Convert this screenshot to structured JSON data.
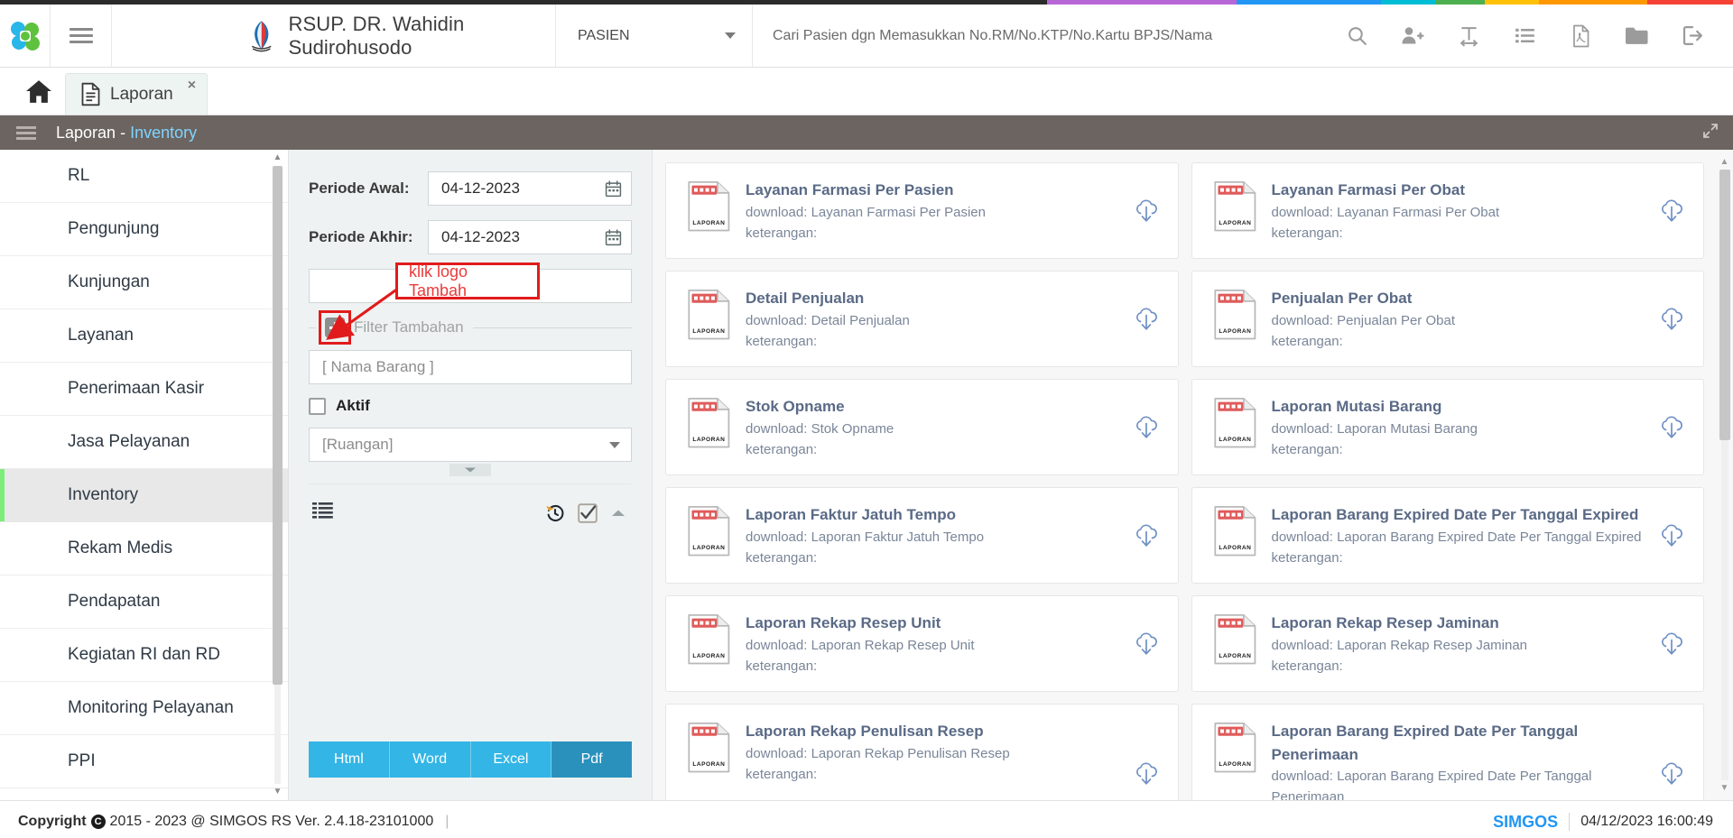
{
  "rainbow_colors": [
    "#2b2b2b",
    "#b766d6",
    "#2196f3",
    "#00bcd4",
    "#4caf50",
    "#ffc107",
    "#ff9800",
    "#f44336"
  ],
  "header": {
    "logo_icon": "simgos-logo-icon",
    "menu_icon": "hamburger-icon",
    "hospital_icon": "hospital-logo-icon",
    "hospital_name": "RSUP. DR. Wahidin Sudirohusodo",
    "select": {
      "value": "PASIEN",
      "caret_icon": "chevron-down-icon"
    },
    "search": {
      "value": "",
      "placeholder": "Cari Pasien dgn Memasukkan No.RM/No.KTP/No.Kartu BPJS/Nama"
    },
    "icons": [
      {
        "name": "search-icon",
        "title": "Cari"
      },
      {
        "name": "add-user-icon",
        "title": "Tambah Pasien"
      },
      {
        "name": "text-width-icon",
        "title": "Teks"
      },
      {
        "name": "list-icon",
        "title": "Daftar"
      },
      {
        "name": "pdf-file-icon",
        "title": "PDF"
      },
      {
        "name": "folder-icon",
        "title": "Folder"
      },
      {
        "name": "logout-icon",
        "title": "Keluar"
      }
    ]
  },
  "tabbar": {
    "home_icon": "home-icon",
    "tabs": [
      {
        "label": "Laporan",
        "icon": "document-icon",
        "close": "×",
        "active": true
      }
    ]
  },
  "titlebar": {
    "menu_icon": "hamburger-icon",
    "title_main": "Laporan",
    "title_sep": " - ",
    "title_accent": "Inventory",
    "expand_icon": "expand-icon"
  },
  "sidebar": {
    "items": [
      {
        "label": "RL",
        "active": false
      },
      {
        "label": "Pengunjung",
        "active": false
      },
      {
        "label": "Kunjungan",
        "active": false
      },
      {
        "label": "Layanan",
        "active": false
      },
      {
        "label": "Penerimaan Kasir",
        "active": false
      },
      {
        "label": "Jasa Pelayanan",
        "active": false
      },
      {
        "label": "Inventory",
        "active": true
      },
      {
        "label": "Rekam Medis",
        "active": false
      },
      {
        "label": "Pendapatan",
        "active": false
      },
      {
        "label": "Kegiatan RI dan RD",
        "active": false
      },
      {
        "label": "Monitoring Pelayanan",
        "active": false
      },
      {
        "label": "PPI",
        "active": false
      }
    ],
    "scroll_up_icon": "caret-up-icon",
    "scroll_down_icon": "caret-down-icon",
    "accent_color": "#7ced7b"
  },
  "filter": {
    "periode_awal_label": "Periode Awal:",
    "periode_awal_value": "04-12-2023",
    "periode_akhir_label": "Periode Akhir:",
    "periode_akhir_value": "04-12-2023",
    "calendar_icon": "calendar-icon",
    "blank_input_value": "",
    "plus_icon": "plus-square-icon",
    "separator_label": "Filter Tambahan",
    "nama_barang_placeholder": "[ Nama Barang ]",
    "aktif_label": "Aktif",
    "aktif_checked": false,
    "ruangan_placeholder": "[Ruangan]",
    "ruangan_caret_icon": "chevron-down-icon",
    "resize_handle_icon": "caret-down-icon",
    "toolbar": {
      "list_icon": "list-bullets-icon",
      "history_icon": "history-reset-icon",
      "checkall_icon": "check-square-icon",
      "collapse_icon": "caret-up-icon"
    },
    "exports": [
      {
        "label": "Html",
        "color": "#33b5e5",
        "active": false
      },
      {
        "label": "Word",
        "color": "#33b5e5",
        "active": false
      },
      {
        "label": "Excel",
        "color": "#33b5e5",
        "active": false
      },
      {
        "label": "Pdf",
        "color": "#2a91bd",
        "active": true
      }
    ]
  },
  "annotation": {
    "text": "klik logo Tambah",
    "color": "#e11b1b"
  },
  "reports": {
    "download_prefix": "download: ",
    "keterangan_label": "keterangan:",
    "icon_name": "report-file-icon",
    "download_icon": "cloud-download-icon",
    "items": [
      {
        "title": "Layanan Farmasi Per Pasien",
        "download": "Layanan Farmasi Per Pasien",
        "keterangan": ""
      },
      {
        "title": "Layanan Farmasi Per Obat",
        "download": "Layanan Farmasi Per Obat",
        "keterangan": ""
      },
      {
        "title": "Detail Penjualan",
        "download": "Detail Penjualan",
        "keterangan": ""
      },
      {
        "title": "Penjualan Per Obat",
        "download": "Penjualan Per Obat",
        "keterangan": ""
      },
      {
        "title": "Stok Opname",
        "download": "Stok Opname",
        "keterangan": ""
      },
      {
        "title": "Laporan Mutasi Barang",
        "download": "Laporan Mutasi Barang",
        "keterangan": ""
      },
      {
        "title": "Laporan Faktur Jatuh Tempo",
        "download": "Laporan Faktur Jatuh Tempo",
        "keterangan": ""
      },
      {
        "title": "Laporan Barang Expired Date Per Tanggal Expired",
        "download": "Laporan Barang Expired Date Per Tanggal Expired",
        "keterangan": ""
      },
      {
        "title": "Laporan Rekap Resep Unit",
        "download": "Laporan Rekap Resep Unit",
        "keterangan": ""
      },
      {
        "title": "Laporan Rekap Resep Jaminan",
        "download": "Laporan Rekap Resep Jaminan",
        "keterangan": ""
      },
      {
        "title": "Laporan Rekap Penulisan Resep",
        "download": "Laporan Rekap Penulisan Resep",
        "keterangan": ""
      },
      {
        "title": "Laporan Barang Expired Date Per Tanggal Penerimaan",
        "download": "Laporan Barang Expired Date Per Tanggal Penerimaan",
        "keterangan": ""
      }
    ]
  },
  "footer": {
    "copyright_word": "Copyright",
    "copyright_mark": "C",
    "copyright_rest": "2015 - 2023 @ SIMGOS RS Ver. 2.4.18-23101000",
    "brand": "SIMGOS",
    "timestamp": "04/12/2023 16:00:49"
  }
}
